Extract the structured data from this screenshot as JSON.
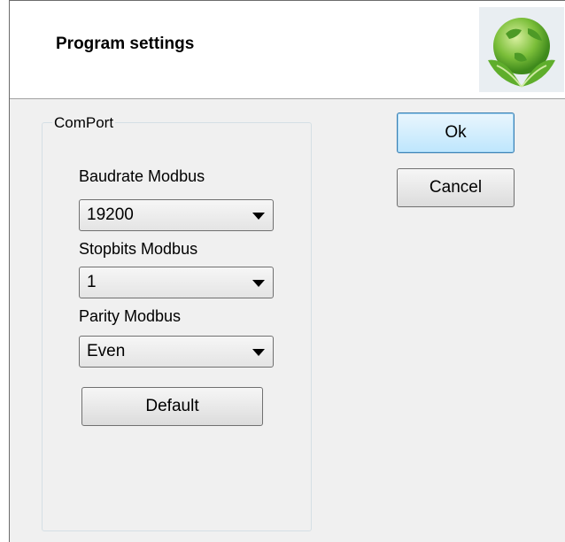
{
  "dialog": {
    "title": "Program settings",
    "logo_icon": "globe-leaf-logo-icon"
  },
  "comport": {
    "group_label": "ComPort",
    "baudrate": {
      "label": "Baudrate Modbus",
      "value": "19200"
    },
    "stopbits": {
      "label": "Stopbits Modbus",
      "value": "1"
    },
    "parity": {
      "label": "Parity Modbus",
      "value": "Even"
    },
    "default_label": "Default"
  },
  "buttons": {
    "ok_label": "Ok",
    "cancel_label": "Cancel"
  },
  "colors": {
    "dialog_bg": "#f0f0f0",
    "header_bg": "#ffffff",
    "primary_border": "#3c7fb1",
    "primary_fill": "#bee6fd"
  }
}
